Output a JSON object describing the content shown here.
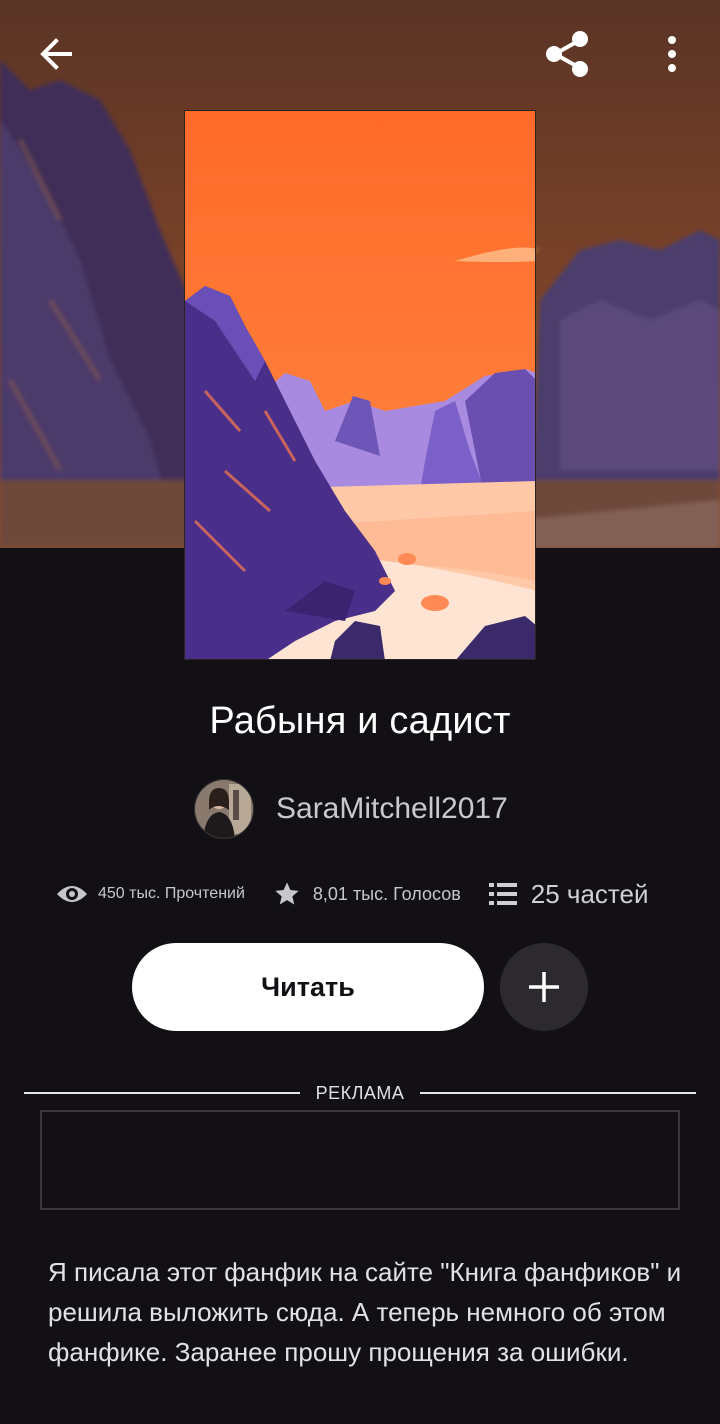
{
  "header": {
    "back_icon": "arrow-left-icon",
    "share_icon": "share-icon",
    "more_icon": "more-vertical-icon"
  },
  "story": {
    "title": "Рабыня и садист",
    "author": "SaraMitchell2017",
    "stats": {
      "views": "450 тыс. Прочтений",
      "votes": "8,01 тыс. Голосов",
      "parts": "25 частей"
    },
    "description": "Я писала этот фанфик на сайте \"Книга фанфиков\" и решила выложить сюда. А теперь немного об этом фанфике. Заранее прошу прощения за ошибки."
  },
  "actions": {
    "read_label": "Читать",
    "add_icon": "plus-icon"
  },
  "ad": {
    "label": "РЕКЛАМА"
  },
  "colors": {
    "background": "#121014",
    "cover_sky": "#ff7a35",
    "rock_purple": "#5a3f9a",
    "button_white": "#ffffff"
  }
}
